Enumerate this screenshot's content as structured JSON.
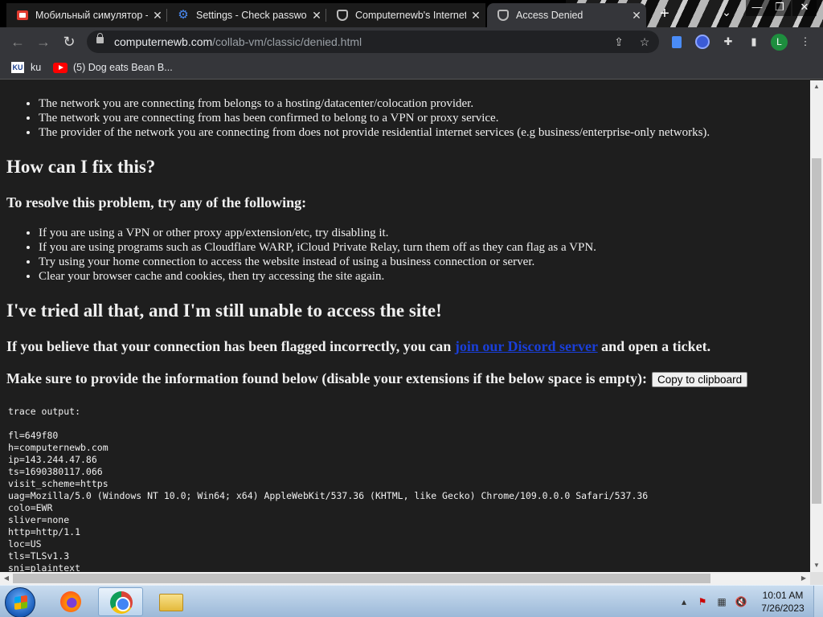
{
  "browser": {
    "tabs": [
      {
        "title": "Мобильный симулятор -",
        "favicon": "red-flag-icon",
        "active": false
      },
      {
        "title": "Settings - Check passwo",
        "favicon": "gear-icon",
        "active": false
      },
      {
        "title": "Computernewb's Internet",
        "favicon": "shield-icon",
        "active": false
      },
      {
        "title": "Access Denied",
        "favicon": "shield-icon",
        "active": true
      }
    ],
    "new_tab_label": "+",
    "url_host": "computernewb.com",
    "url_path": "/collab-vm/classic/denied.html",
    "profile_initial": "L",
    "bookmarks": [
      {
        "label": "ku",
        "icon": "ku-logo-icon"
      },
      {
        "label": "(5) Dog eats Bean B...",
        "icon": "youtube-icon"
      }
    ]
  },
  "page": {
    "reasons": [
      "The network you are connecting from belongs to a hosting/datacenter/colocation provider.",
      "The network you are connecting from has been confirmed to belong to a VPN or proxy service.",
      "The provider of the network you are connecting from does not provide residential internet services (e.g business/enterprise-only networks)."
    ],
    "fix_heading": "How can I fix this?",
    "resolve_heading": "To resolve this problem, try any of the following:",
    "fixes": [
      "If you are using a VPN or other proxy app/extension/etc, try disabling it.",
      "If you are using programs such as Cloudflare WARP, iCloud Private Relay, turn them off as they can flag as a VPN.",
      "Try using your home connection to access the website instead of using a business connection or server.",
      "Clear your browser cache and cookies, then try accessing the site again."
    ],
    "still_heading": "I've tried all that, and I'm still unable to access the site!",
    "flagged_before": "If you believe that your connection has been flagged incorrectly, you can ",
    "discord_link": "join our Discord server",
    "flagged_after": " and open a ticket.",
    "info_text": "Make sure to provide the information found below (disable your extensions if the below space is empty):",
    "copy_button": "Copy to clipboard",
    "trace": "trace output:\n\nfl=649f80\nh=computernewb.com\nip=143.244.47.86\nts=1690380117.066\nvisit_scheme=https\nuag=Mozilla/5.0 (Windows NT 10.0; Win64; x64) AppleWebKit/537.36 (KHTML, like Gecko) Chrome/109.0.0.0 Safari/537.36\ncolo=EWR\nsliver=none\nhttp=http/1.1\nloc=US\ntls=TLSv1.3\nsni=plaintext"
  },
  "taskbar": {
    "time": "10:01 AM",
    "date": "7/26/2023",
    "apps": [
      "firefox-icon",
      "chrome-icon",
      "file-explorer-icon"
    ]
  }
}
